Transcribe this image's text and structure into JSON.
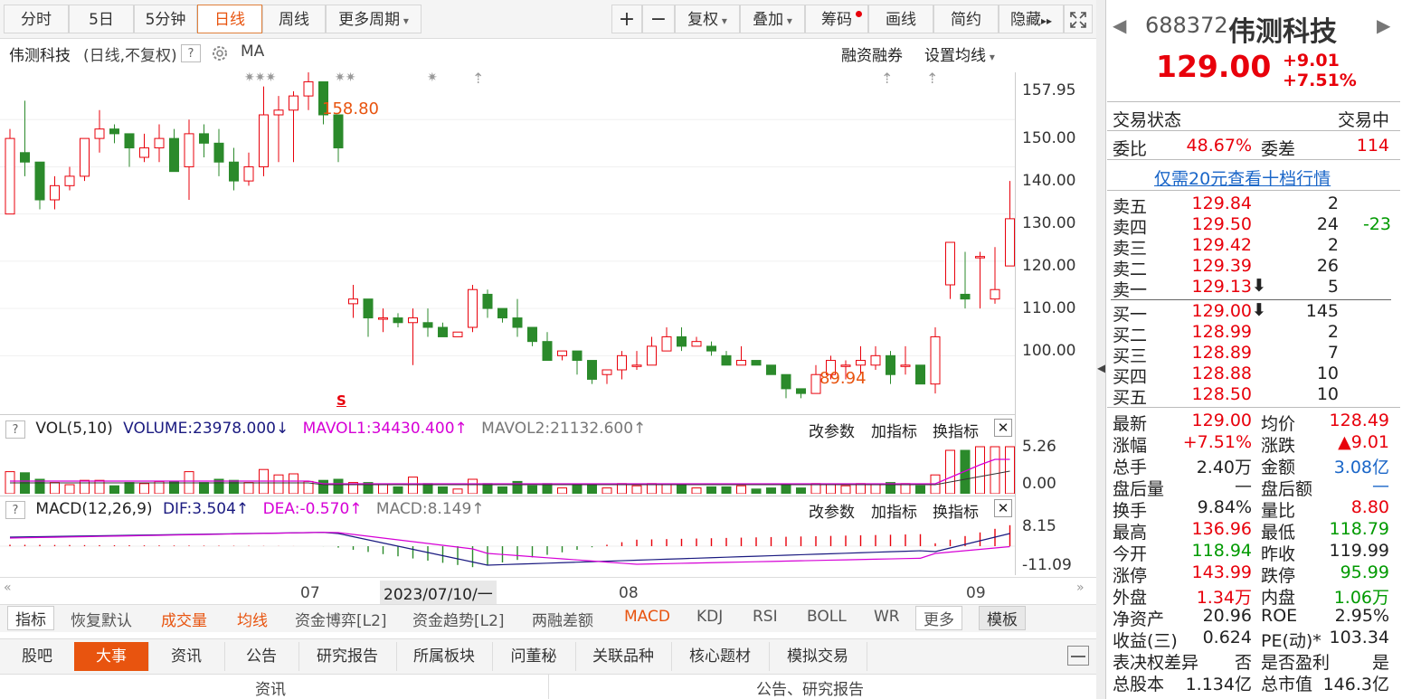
{
  "toolbar": {
    "tabs": [
      "分时",
      "5日",
      "5分钟",
      "日线",
      "周线",
      "更多周期"
    ],
    "tools": [
      "复权",
      "叠加",
      "筹码",
      "画线",
      "简约",
      "隐藏"
    ],
    "plus": "+",
    "minus": "−"
  },
  "chart": {
    "title": "伟测科技",
    "mode": "(日线,不复权)",
    "help": "?",
    "ma_label": "MA",
    "margin_label": "融资融券",
    "set_ma_label": "设置均线",
    "price_axis": [
      "157.95",
      "150.00",
      "140.00",
      "130.00",
      "120.00",
      "110.00",
      "100.00"
    ],
    "high_marker": "158.80",
    "low_marker": "89.94",
    "event_marker": "S",
    "star_markers": [
      "✷✷✷",
      "✷✷",
      "✷"
    ],
    "up_arrow": "⇡",
    "candles": [
      [
        130,
        148,
        131,
        146
      ],
      [
        143,
        154,
        138,
        141
      ],
      [
        141,
        141,
        131,
        133
      ],
      [
        133,
        138,
        131,
        136
      ],
      [
        136,
        140,
        135,
        138
      ],
      [
        138,
        146,
        137,
        146
      ],
      [
        146,
        152,
        143,
        148
      ],
      [
        148,
        149,
        145,
        147
      ],
      [
        147,
        147,
        140,
        144
      ],
      [
        142,
        147,
        141,
        144
      ],
      [
        144,
        149,
        141,
        146
      ],
      [
        146,
        148,
        140,
        139
      ],
      [
        140,
        150,
        133,
        147
      ],
      [
        147,
        149,
        142,
        145
      ],
      [
        145,
        148,
        138,
        141
      ],
      [
        141,
        144,
        135,
        137
      ],
      [
        137,
        143,
        136,
        140
      ],
      [
        140,
        157,
        138,
        151
      ],
      [
        151,
        155,
        141,
        152
      ],
      [
        152,
        156,
        141,
        155
      ],
      [
        155,
        160,
        152,
        158
      ],
      [
        158,
        158,
        149,
        151
      ],
      [
        151,
        151,
        141,
        144
      ],
      [
        111,
        115,
        108,
        112
      ],
      [
        112,
        111,
        104,
        108
      ],
      [
        108,
        110,
        105,
        108
      ],
      [
        108,
        109,
        106,
        107
      ],
      [
        107,
        110,
        98,
        108
      ],
      [
        107,
        110,
        104,
        106
      ],
      [
        106,
        107,
        104,
        104
      ],
      [
        104,
        105,
        104,
        105
      ],
      [
        106,
        115,
        105,
        114
      ],
      [
        113,
        114,
        108,
        110
      ],
      [
        110,
        110,
        107,
        108
      ],
      [
        108,
        112,
        104,
        106
      ],
      [
        106,
        106,
        102,
        103
      ],
      [
        103,
        105,
        99,
        99
      ],
      [
        100,
        101,
        99,
        101
      ],
      [
        101,
        101,
        96,
        99
      ],
      [
        99,
        99,
        94,
        95
      ],
      [
        96,
        96,
        94,
        97
      ],
      [
        97,
        101,
        95,
        100
      ],
      [
        98,
        101,
        97,
        98
      ],
      [
        98,
        104,
        98,
        102
      ],
      [
        101,
        106,
        101,
        104
      ],
      [
        104,
        106,
        101,
        102
      ],
      [
        102,
        104,
        102,
        103
      ],
      [
        102,
        103,
        100,
        101
      ],
      [
        100,
        101,
        98,
        98
      ],
      [
        98,
        102,
        98,
        99
      ],
      [
        99,
        99,
        98,
        98
      ],
      [
        98,
        98,
        96,
        96
      ],
      [
        96,
        96,
        91,
        93
      ],
      [
        93,
        93,
        91,
        92
      ],
      [
        92,
        98,
        92,
        96
      ],
      [
        96,
        100,
        95,
        99
      ],
      [
        98,
        99,
        95,
        98
      ],
      [
        98,
        102,
        96,
        99
      ],
      [
        98,
        102,
        97,
        100
      ],
      [
        100,
        101,
        94,
        96
      ],
      [
        98,
        102,
        96,
        98
      ],
      [
        98,
        98,
        94,
        94
      ],
      [
        94,
        106,
        92,
        104
      ],
      [
        115,
        124,
        112,
        124
      ],
      [
        113,
        122,
        110,
        112
      ],
      [
        121,
        122,
        110,
        121
      ],
      [
        112,
        123,
        111,
        114
      ],
      [
        119,
        137,
        119,
        129
      ]
    ],
    "vol_label": "VOL(5,10)",
    "volume": "VOLUME:23978.000",
    "mavol1": "MAVOL1:34430.400",
    "mavol2": "MAVOL2:21132.600",
    "vol_axis": [
      "5.26",
      "0.00"
    ],
    "macd_label": "MACD(12,26,9)",
    "dif": "DIF:3.504",
    "dea": "DEA:-0.570",
    "macd": "MACD:8.149",
    "macd_axis": [
      "8.15",
      "-11.09"
    ],
    "panel_actions": [
      "改参数",
      "加指标",
      "换指标"
    ],
    "date_labels": [
      "07",
      "2023/07/10/一",
      "08",
      "09"
    ]
  },
  "indicator_tabs": [
    "指标",
    "恢复默认",
    "成交量",
    "均线",
    "资金博弈[L2]",
    "资金趋势[L2]",
    "两融差额",
    "MACD",
    "KDJ",
    "RSI",
    "BOLL",
    "WR",
    "更多",
    "模板"
  ],
  "bottom_tabs": [
    "股吧",
    "大事",
    "资讯",
    "公告",
    "研究报告",
    "所属板块",
    "问董秘",
    "关联品种",
    "核心题材",
    "模拟交易"
  ],
  "bottom_sub": [
    "资讯",
    "公告、研究报告"
  ],
  "quote": {
    "code": "688372",
    "name": "伟测科技",
    "price": "129.00",
    "change": "+9.01",
    "change_pct": "+7.51%",
    "status_label": "交易状态",
    "status": "交易中",
    "weibi_label": "委比",
    "weibi": "48.67%",
    "weicha_label": "委差",
    "weicha": "114",
    "ten_level_link": "仅需20元查看十档行情",
    "asks": [
      {
        "label": "卖五",
        "price": "129.84",
        "vol": "2",
        "chg": ""
      },
      {
        "label": "卖四",
        "price": "129.50",
        "vol": "24",
        "chg": "-23"
      },
      {
        "label": "卖三",
        "price": "129.42",
        "vol": "2",
        "chg": ""
      },
      {
        "label": "卖二",
        "price": "129.39",
        "vol": "26",
        "chg": ""
      },
      {
        "label": "卖一",
        "price": "129.13",
        "vol": "5",
        "chg": ""
      }
    ],
    "bids": [
      {
        "label": "买一",
        "price": "129.00",
        "vol": "145",
        "chg": ""
      },
      {
        "label": "买二",
        "price": "128.99",
        "vol": "2",
        "chg": ""
      },
      {
        "label": "买三",
        "price": "128.89",
        "vol": "7",
        "chg": ""
      },
      {
        "label": "买四",
        "price": "128.88",
        "vol": "10",
        "chg": ""
      },
      {
        "label": "买五",
        "price": "128.50",
        "vol": "10",
        "chg": ""
      }
    ],
    "stats": [
      [
        "最新",
        "129.00",
        "red",
        "均价",
        "128.49",
        "red"
      ],
      [
        "涨幅",
        "+7.51%",
        "red",
        "涨跌",
        "▲9.01",
        "red"
      ],
      [
        "总手",
        "2.40万",
        "blk",
        "金额",
        "3.08亿",
        "blu"
      ],
      [
        "盘后量",
        "—",
        "blk",
        "盘后额",
        "—",
        "blu"
      ],
      [
        "换手",
        "9.84%",
        "blk",
        "量比",
        "8.80",
        "red"
      ],
      [
        "最高",
        "136.96",
        "red",
        "最低",
        "118.79",
        "grn"
      ],
      [
        "今开",
        "118.94",
        "grn",
        "昨收",
        "119.99",
        "blk"
      ],
      [
        "涨停",
        "143.99",
        "red",
        "跌停",
        "95.99",
        "grn"
      ],
      [
        "外盘",
        "1.34万",
        "red",
        "内盘",
        "1.06万",
        "grn"
      ],
      [
        "净资产",
        "20.96",
        "blk",
        "ROE",
        "2.95%",
        "blk"
      ],
      [
        "收益(三)",
        "0.624",
        "blk",
        "PE(动)*",
        "103.34",
        "blk"
      ],
      [
        "表决权差异",
        "否",
        "blk",
        "是否盈利",
        "是",
        "blk"
      ],
      [
        "总股本",
        "1.134亿",
        "blk",
        "总市值",
        "146.3亿",
        "blk"
      ]
    ]
  }
}
